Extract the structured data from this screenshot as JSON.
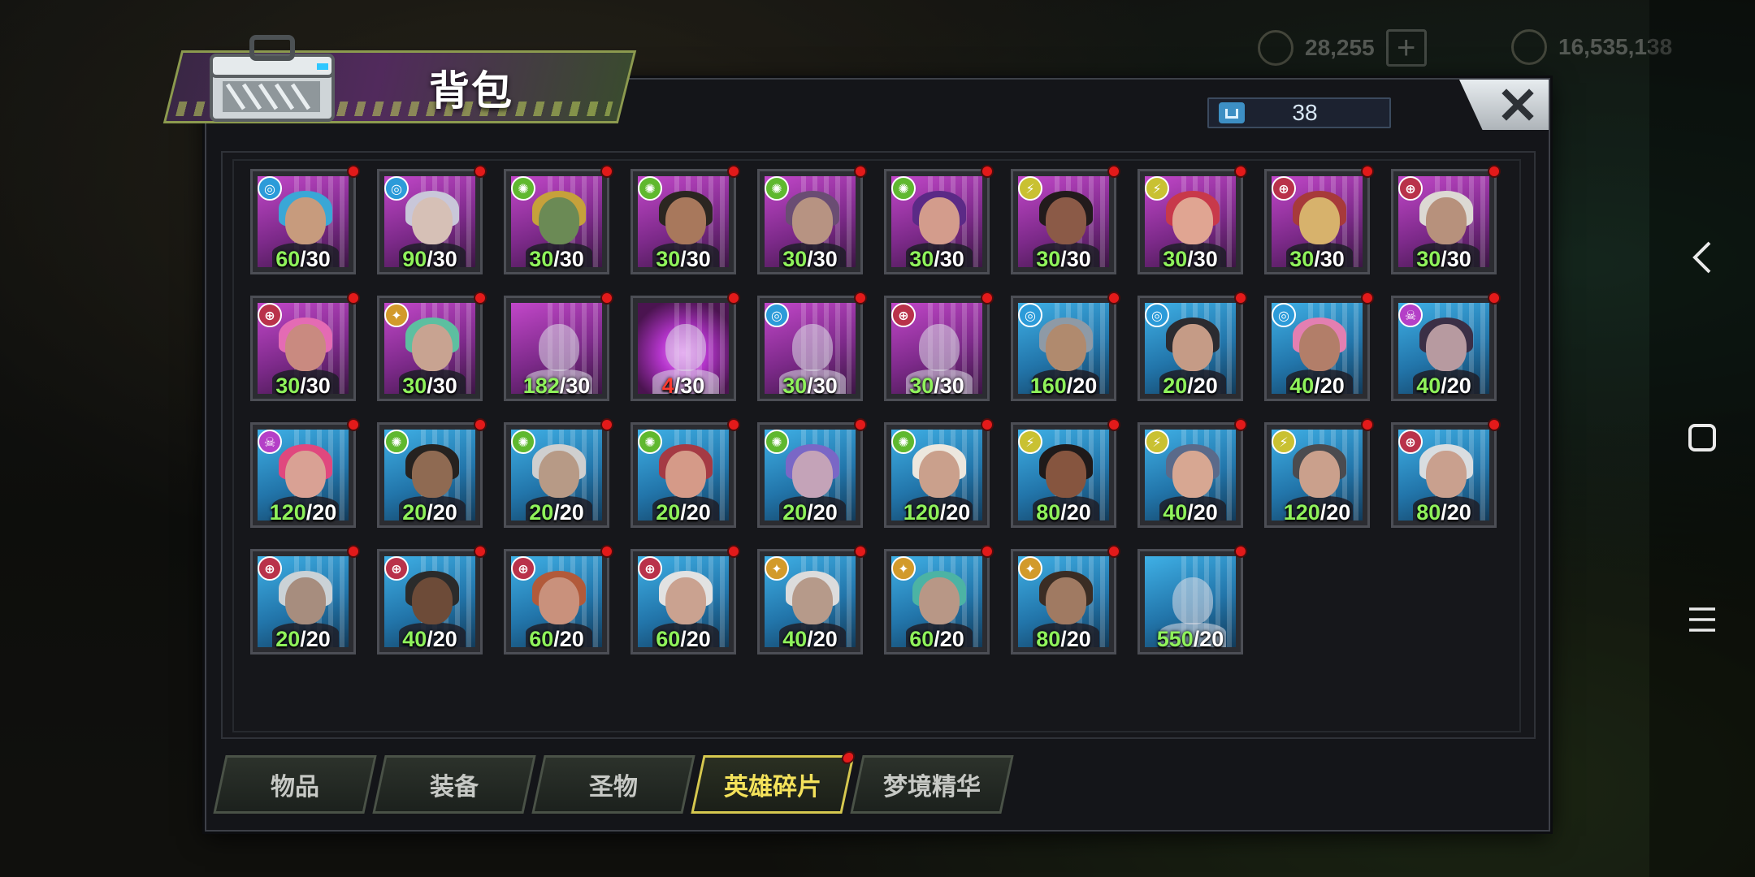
{
  "panel": {
    "title": "背包",
    "capacity": "38",
    "close_icon": "close-x-icon"
  },
  "background_hud": {
    "currency_1": "28,255",
    "currency_2": "16,535,138"
  },
  "colors": {
    "have_ok": "#8ff25b",
    "have_low": "#ff3b30",
    "active_tab": "#f4e25b",
    "notification_dot": "#e31a1a"
  },
  "cards": [
    {
      "have": "60",
      "need": "30",
      "rarity": "purple",
      "faction": "tech",
      "face": "#c79b7d",
      "hair": "#3aa7d6"
    },
    {
      "have": "90",
      "need": "30",
      "rarity": "purple",
      "faction": "tech",
      "face": "#d6c0b6",
      "hair": "#c9c7d9"
    },
    {
      "have": "30",
      "need": "30",
      "rarity": "purple",
      "faction": "nature",
      "face": "#6b8a55",
      "hair": "#c6a13b"
    },
    {
      "have": "30",
      "need": "30",
      "rarity": "purple",
      "faction": "nature",
      "face": "#a8785c",
      "hair": "#2b2621"
    },
    {
      "have": "30",
      "need": "30",
      "rarity": "purple",
      "faction": "nature",
      "face": "#b79382",
      "hair": "#6a4d73"
    },
    {
      "have": "30",
      "need": "30",
      "rarity": "purple",
      "faction": "nature",
      "face": "#d39c8c",
      "hair": "#5b2a86"
    },
    {
      "have": "30",
      "need": "30",
      "rarity": "purple",
      "faction": "chaos",
      "face": "#8b5a47",
      "hair": "#221b1c"
    },
    {
      "have": "30",
      "need": "30",
      "rarity": "purple",
      "faction": "chaos",
      "face": "#e0a592",
      "hair": "#c8394a"
    },
    {
      "have": "30",
      "need": "30",
      "rarity": "purple",
      "faction": "order",
      "face": "#d7b26c",
      "hair": "#a73a3a"
    },
    {
      "have": "30",
      "need": "30",
      "rarity": "purple",
      "faction": "order",
      "face": "#b7917c",
      "hair": "#dcd9d3"
    },
    {
      "have": "30",
      "need": "30",
      "rarity": "purple",
      "faction": "order",
      "face": "#c98a80",
      "hair": "#e46bb4"
    },
    {
      "have": "30",
      "need": "30",
      "rarity": "purple",
      "faction": "star",
      "face": "#c8a391",
      "hair": "#5dbfa0"
    },
    {
      "have": "182",
      "need": "30",
      "rarity": "purple",
      "faction": "none",
      "placeholder": true
    },
    {
      "have": "4",
      "need": "30",
      "rarity": "purple",
      "faction": "none",
      "placeholder": true,
      "glow": true
    },
    {
      "have": "30",
      "need": "30",
      "rarity": "purple",
      "faction": "tech",
      "placeholder": true
    },
    {
      "have": "30",
      "need": "30",
      "rarity": "purple",
      "faction": "order",
      "placeholder": true
    },
    {
      "have": "160",
      "need": "20",
      "rarity": "blue",
      "faction": "tech",
      "face": "#b08a6e",
      "hair": "#8e9aa6"
    },
    {
      "have": "20",
      "need": "20",
      "rarity": "blue",
      "faction": "tech",
      "face": "#c59b86",
      "hair": "#2b2b30"
    },
    {
      "have": "40",
      "need": "20",
      "rarity": "blue",
      "faction": "tech",
      "face": "#b27e69",
      "hair": "#e37fb1"
    },
    {
      "have": "40",
      "need": "20",
      "rarity": "blue",
      "faction": "skull",
      "face": "#b79aa0",
      "hair": "#3b2f46"
    },
    {
      "have": "120",
      "need": "20",
      "rarity": "blue",
      "faction": "skull",
      "face": "#d9a194",
      "hair": "#e0487e"
    },
    {
      "have": "20",
      "need": "20",
      "rarity": "blue",
      "faction": "nature",
      "face": "#8f6a52",
      "hair": "#262220"
    },
    {
      "have": "20",
      "need": "20",
      "rarity": "blue",
      "faction": "nature",
      "face": "#b79a86",
      "hair": "#cfcfcf"
    },
    {
      "have": "20",
      "need": "20",
      "rarity": "blue",
      "faction": "nature",
      "face": "#d59a88",
      "hair": "#a53a44"
    },
    {
      "have": "20",
      "need": "20",
      "rarity": "blue",
      "faction": "nature",
      "face": "#c4a3b8",
      "hair": "#7a67c6"
    },
    {
      "have": "120",
      "need": "20",
      "rarity": "blue",
      "faction": "nature",
      "face": "#caa08c",
      "hair": "#ece7de"
    },
    {
      "have": "80",
      "need": "20",
      "rarity": "blue",
      "faction": "chaos",
      "face": "#86553f",
      "hair": "#1f1a1a"
    },
    {
      "have": "40",
      "need": "20",
      "rarity": "blue",
      "faction": "chaos",
      "face": "#d7a792",
      "hair": "#5a6a8a"
    },
    {
      "have": "120",
      "need": "20",
      "rarity": "blue",
      "faction": "chaos",
      "face": "#caa08c",
      "hair": "#4b4b4f"
    },
    {
      "have": "80",
      "need": "20",
      "rarity": "blue",
      "faction": "order",
      "face": "#c9a08e",
      "hair": "#d9dde0"
    },
    {
      "have": "20",
      "need": "20",
      "rarity": "blue",
      "faction": "order",
      "face": "#a78d7e",
      "hair": "#cbd2d6"
    },
    {
      "have": "40",
      "need": "20",
      "rarity": "blue",
      "faction": "order",
      "face": "#6d4b38",
      "hair": "#2b2b2b"
    },
    {
      "have": "60",
      "need": "20",
      "rarity": "blue",
      "faction": "order",
      "face": "#c9917c",
      "hair": "#b25a3a"
    },
    {
      "have": "60",
      "need": "20",
      "rarity": "blue",
      "faction": "order",
      "face": "#caa290",
      "hair": "#e2e2e2"
    },
    {
      "have": "40",
      "need": "20",
      "rarity": "blue",
      "faction": "star",
      "face": "#b69a8a",
      "hair": "#dcdcdc"
    },
    {
      "have": "60",
      "need": "20",
      "rarity": "blue",
      "faction": "star",
      "face": "#b89786",
      "hair": "#4cb3a4"
    },
    {
      "have": "80",
      "need": "20",
      "rarity": "blue",
      "faction": "star",
      "face": "#a07a62",
      "hair": "#3b2d24"
    },
    {
      "have": "550",
      "need": "20",
      "rarity": "blue",
      "faction": "none",
      "placeholder": true
    }
  ],
  "tabs": [
    {
      "label": "物品",
      "active": false,
      "dot": false
    },
    {
      "label": "装备",
      "active": false,
      "dot": false
    },
    {
      "label": "圣物",
      "active": false,
      "dot": false
    },
    {
      "label": "英雄碎片",
      "active": true,
      "dot": true
    },
    {
      "label": "梦境精华",
      "active": false,
      "dot": false
    }
  ],
  "nav": {
    "back_icon": "back-chevron-icon",
    "home_icon": "home-square-icon",
    "menu_icon": "menu-lines-icon"
  }
}
